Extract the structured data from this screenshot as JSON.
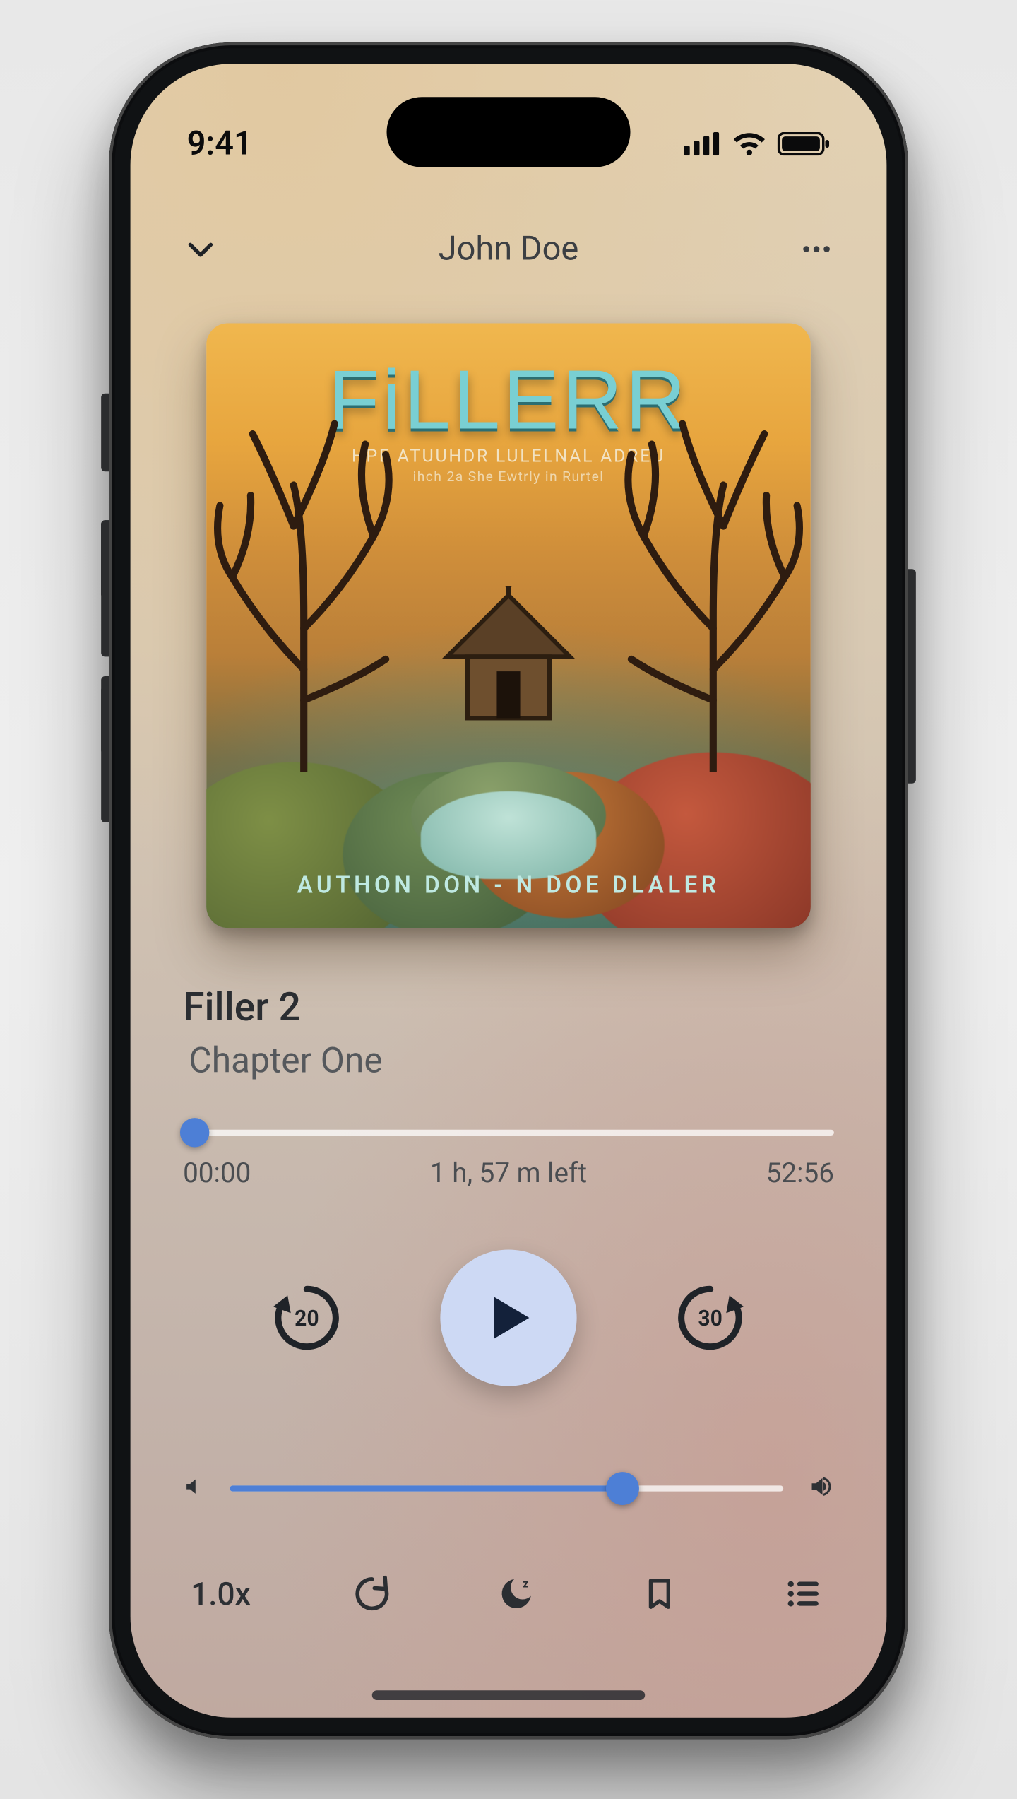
{
  "status": {
    "time": "9:41"
  },
  "header": {
    "author": "John Doe"
  },
  "cover": {
    "title": "FiLLERR",
    "sub1": "HPE ATUUHDR LULELNAL ADREU",
    "sub2": "ihch 2a She Ewtrly in Rurtel",
    "author_line": "AUTHON DON - N DOE DLALER"
  },
  "track": {
    "book_title": "Filler 2",
    "chapter": "Chapter One",
    "elapsed": "00:00",
    "remaining": "1 h, 57 m left",
    "duration": "52:56"
  },
  "transport": {
    "back_sec": "20",
    "fwd_sec": "30"
  },
  "bottom": {
    "speed": "1.0x"
  },
  "colors": {
    "accent": "#4d7fd6"
  }
}
